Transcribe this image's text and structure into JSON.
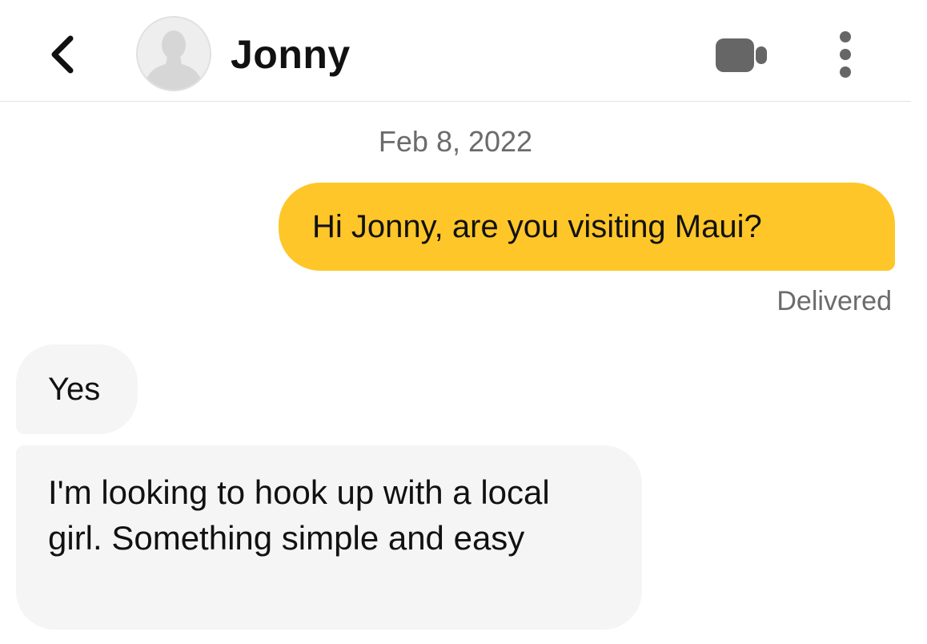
{
  "header": {
    "contact_name": "Jonny",
    "icons": {
      "back": "chevron-left-icon",
      "avatar": "default-user-avatar",
      "video": "video-camera-icon",
      "more": "more-vertical-icon"
    }
  },
  "conversation": {
    "date": "Feb 8, 2022",
    "messages": [
      {
        "direction": "outgoing",
        "text": "Hi Jonny, are you visiting Maui?",
        "status": "Delivered"
      },
      {
        "direction": "incoming",
        "text": "Yes"
      },
      {
        "direction": "incoming",
        "text": "I'm looking to hook up with a local girl. Something simple and easy"
      }
    ]
  },
  "colors": {
    "outgoing_bubble": "#ffc629",
    "incoming_bubble": "#f5f5f5",
    "icon_gray": "#666666",
    "meta_text": "#6b6b6b"
  }
}
